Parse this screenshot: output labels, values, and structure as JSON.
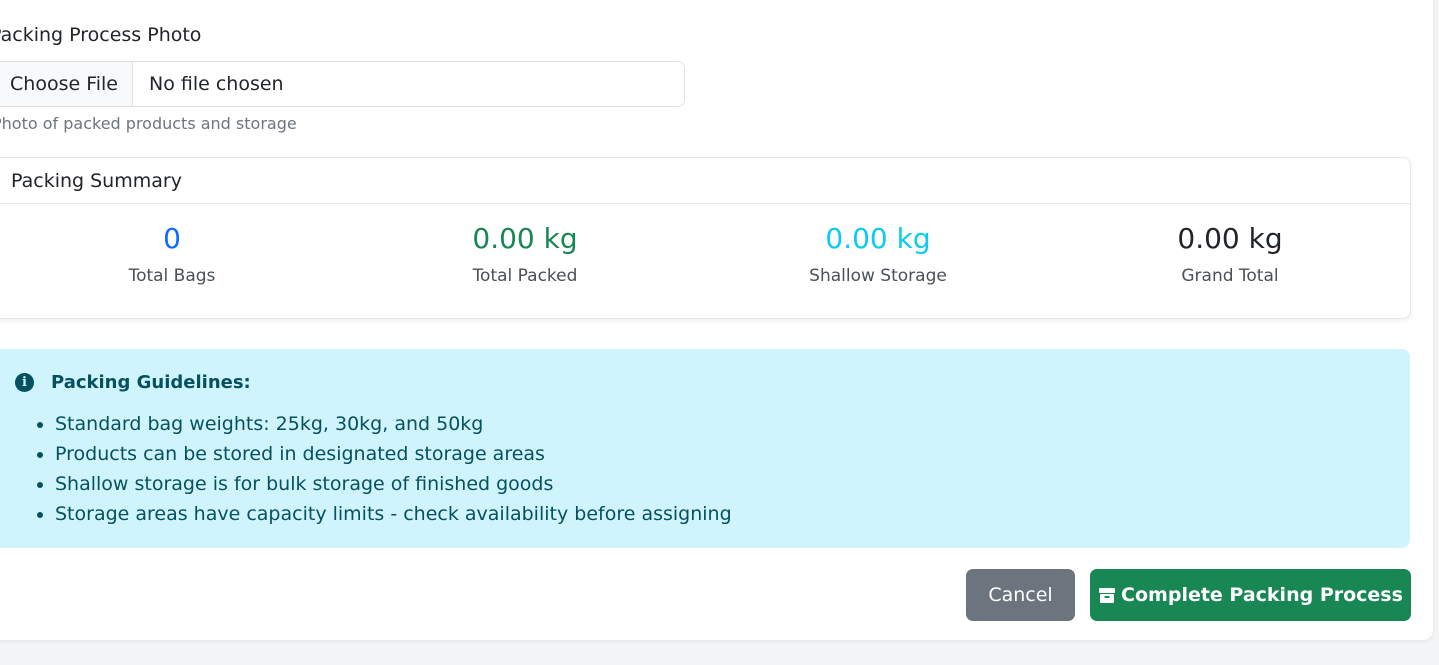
{
  "form": {
    "photo_label": "Packing Process Photo",
    "file_button_label": "Choose File",
    "file_status": "No file chosen",
    "help_text": "Photo of packed products and storage"
  },
  "summary": {
    "title": "Packing Summary",
    "stats": [
      {
        "value": "0",
        "label": "Total Bags",
        "color": "#0d6efd"
      },
      {
        "value": "0.00 kg",
        "label": "Total Packed",
        "color": "#198754"
      },
      {
        "value": "0.00 kg",
        "label": "Shallow Storage",
        "color": "#0dcaf0"
      },
      {
        "value": "0.00 kg",
        "label": "Grand Total",
        "color": "#212529"
      }
    ]
  },
  "guidelines": {
    "icon": "info-circle-icon",
    "title": "Packing Guidelines:",
    "items": [
      "Standard bag weights: 25kg, 30kg, and 50kg",
      "Products can be stored in designated storage areas",
      "Shallow storage is for bulk storage of finished goods",
      "Storage areas have capacity limits - check availability before assigning"
    ]
  },
  "actions": {
    "cancel_label": "Cancel",
    "complete_label": "Complete Packing Process",
    "complete_icon": "box-icon"
  },
  "colors": {
    "info_bg": "#cff4fc",
    "info_text": "#055160",
    "success": "#198754",
    "secondary": "#6c757d"
  }
}
